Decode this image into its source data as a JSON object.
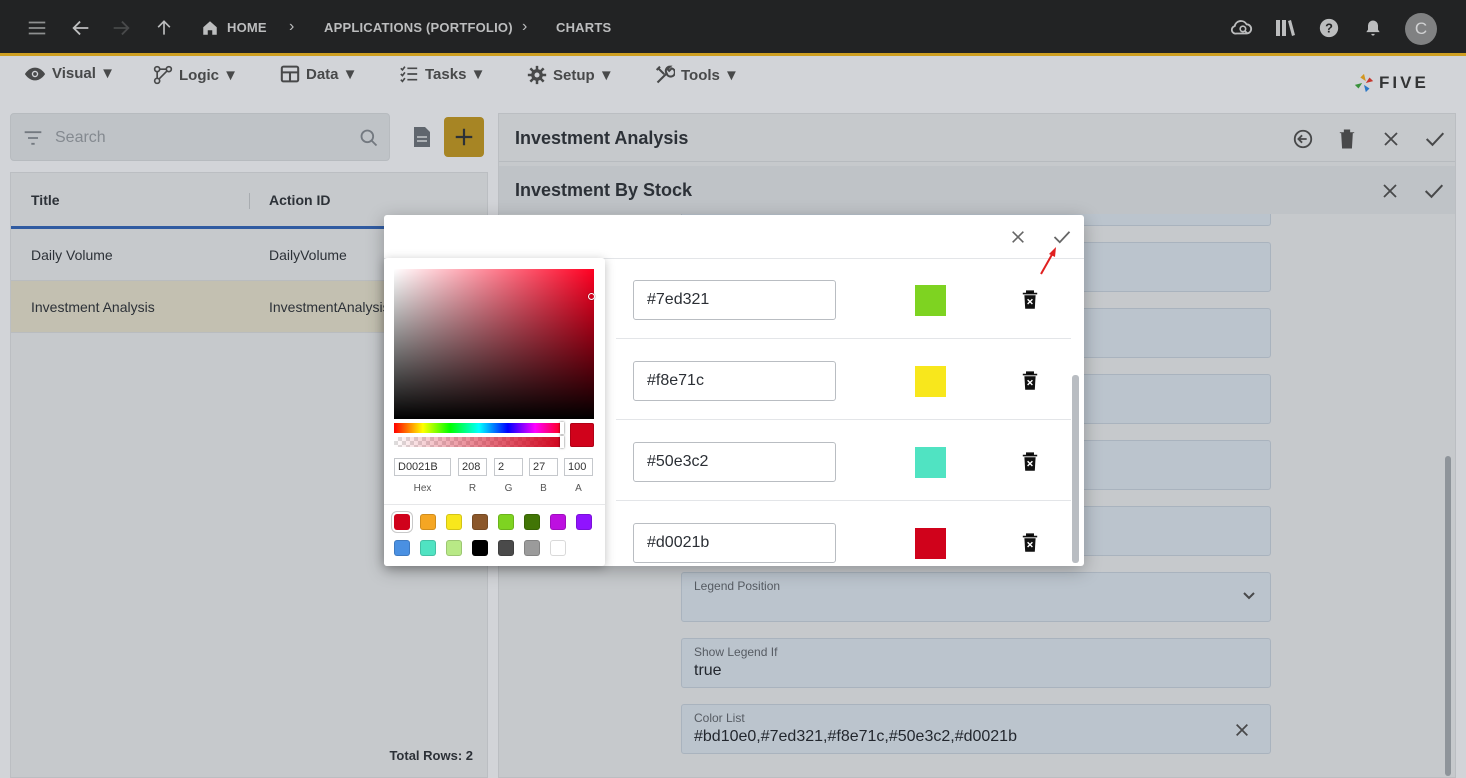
{
  "topbar": {
    "breadcrumbs": [
      "HOME",
      "APPLICATIONS (PORTFOLIO)",
      "CHARTS"
    ],
    "avatar_initial": "C",
    "icons": [
      "menu-icon",
      "back-arrow-icon",
      "forward-arrow-icon",
      "up-arrow-icon",
      "home-icon",
      "cloud-search-icon",
      "library-icon",
      "help-icon",
      "bell-icon"
    ]
  },
  "menu": {
    "items": [
      {
        "label": "Visual ▼",
        "icon": "eye-icon"
      },
      {
        "label": "Logic ▼",
        "icon": "logic-icon"
      },
      {
        "label": "Data ▼",
        "icon": "table-icon"
      },
      {
        "label": "Tasks ▼",
        "icon": "tasks-icon"
      },
      {
        "label": "Setup ▼",
        "icon": "gear-icon"
      },
      {
        "label": "Tools ▼",
        "icon": "tools-icon"
      }
    ],
    "logo_text": "FIVE"
  },
  "left": {
    "search_placeholder": "Search",
    "columns": [
      "Title",
      "Action ID"
    ],
    "rows": [
      {
        "title": "Daily Volume",
        "action_id": "DailyVolume"
      },
      {
        "title": "Investment Analysis",
        "action_id": "InvestmentAnalysis"
      }
    ],
    "total_rows": "Total Rows: 2"
  },
  "right": {
    "title": "Investment Analysis",
    "subtitle": "Investment By Stock",
    "fields": [
      {
        "label": "Legend Position",
        "value": ""
      },
      {
        "label": "Show Legend If",
        "value": "true"
      },
      {
        "label": "Color List",
        "value": "#bd10e0,#7ed321,#f8e71c,#50e3c2,#d0021b"
      }
    ]
  },
  "dialog": {
    "colors": [
      {
        "hex": "#7ed321",
        "swatch": "#7ed321"
      },
      {
        "hex": "#f8e71c",
        "swatch": "#f8e71c"
      },
      {
        "hex": "#50e3c2",
        "swatch": "#50e3c2"
      },
      {
        "hex": "#d0021b",
        "swatch": "#d0021b"
      }
    ]
  },
  "picker": {
    "hex": "D0021B",
    "r": "208",
    "g": "2",
    "b": "27",
    "a": "100",
    "labels": {
      "hex": "Hex",
      "r": "R",
      "g": "G",
      "b": "B",
      "a": "A"
    },
    "presets": [
      "#d0021b",
      "#f5a623",
      "#f8e71c",
      "#8b572a",
      "#7ed321",
      "#417505",
      "#bd10e0",
      "#9013fe",
      "#4a90e2",
      "#50e3c2",
      "#b8e986",
      "#000000",
      "#4a4a4a",
      "#9b9b9b",
      "#ffffff"
    ]
  }
}
